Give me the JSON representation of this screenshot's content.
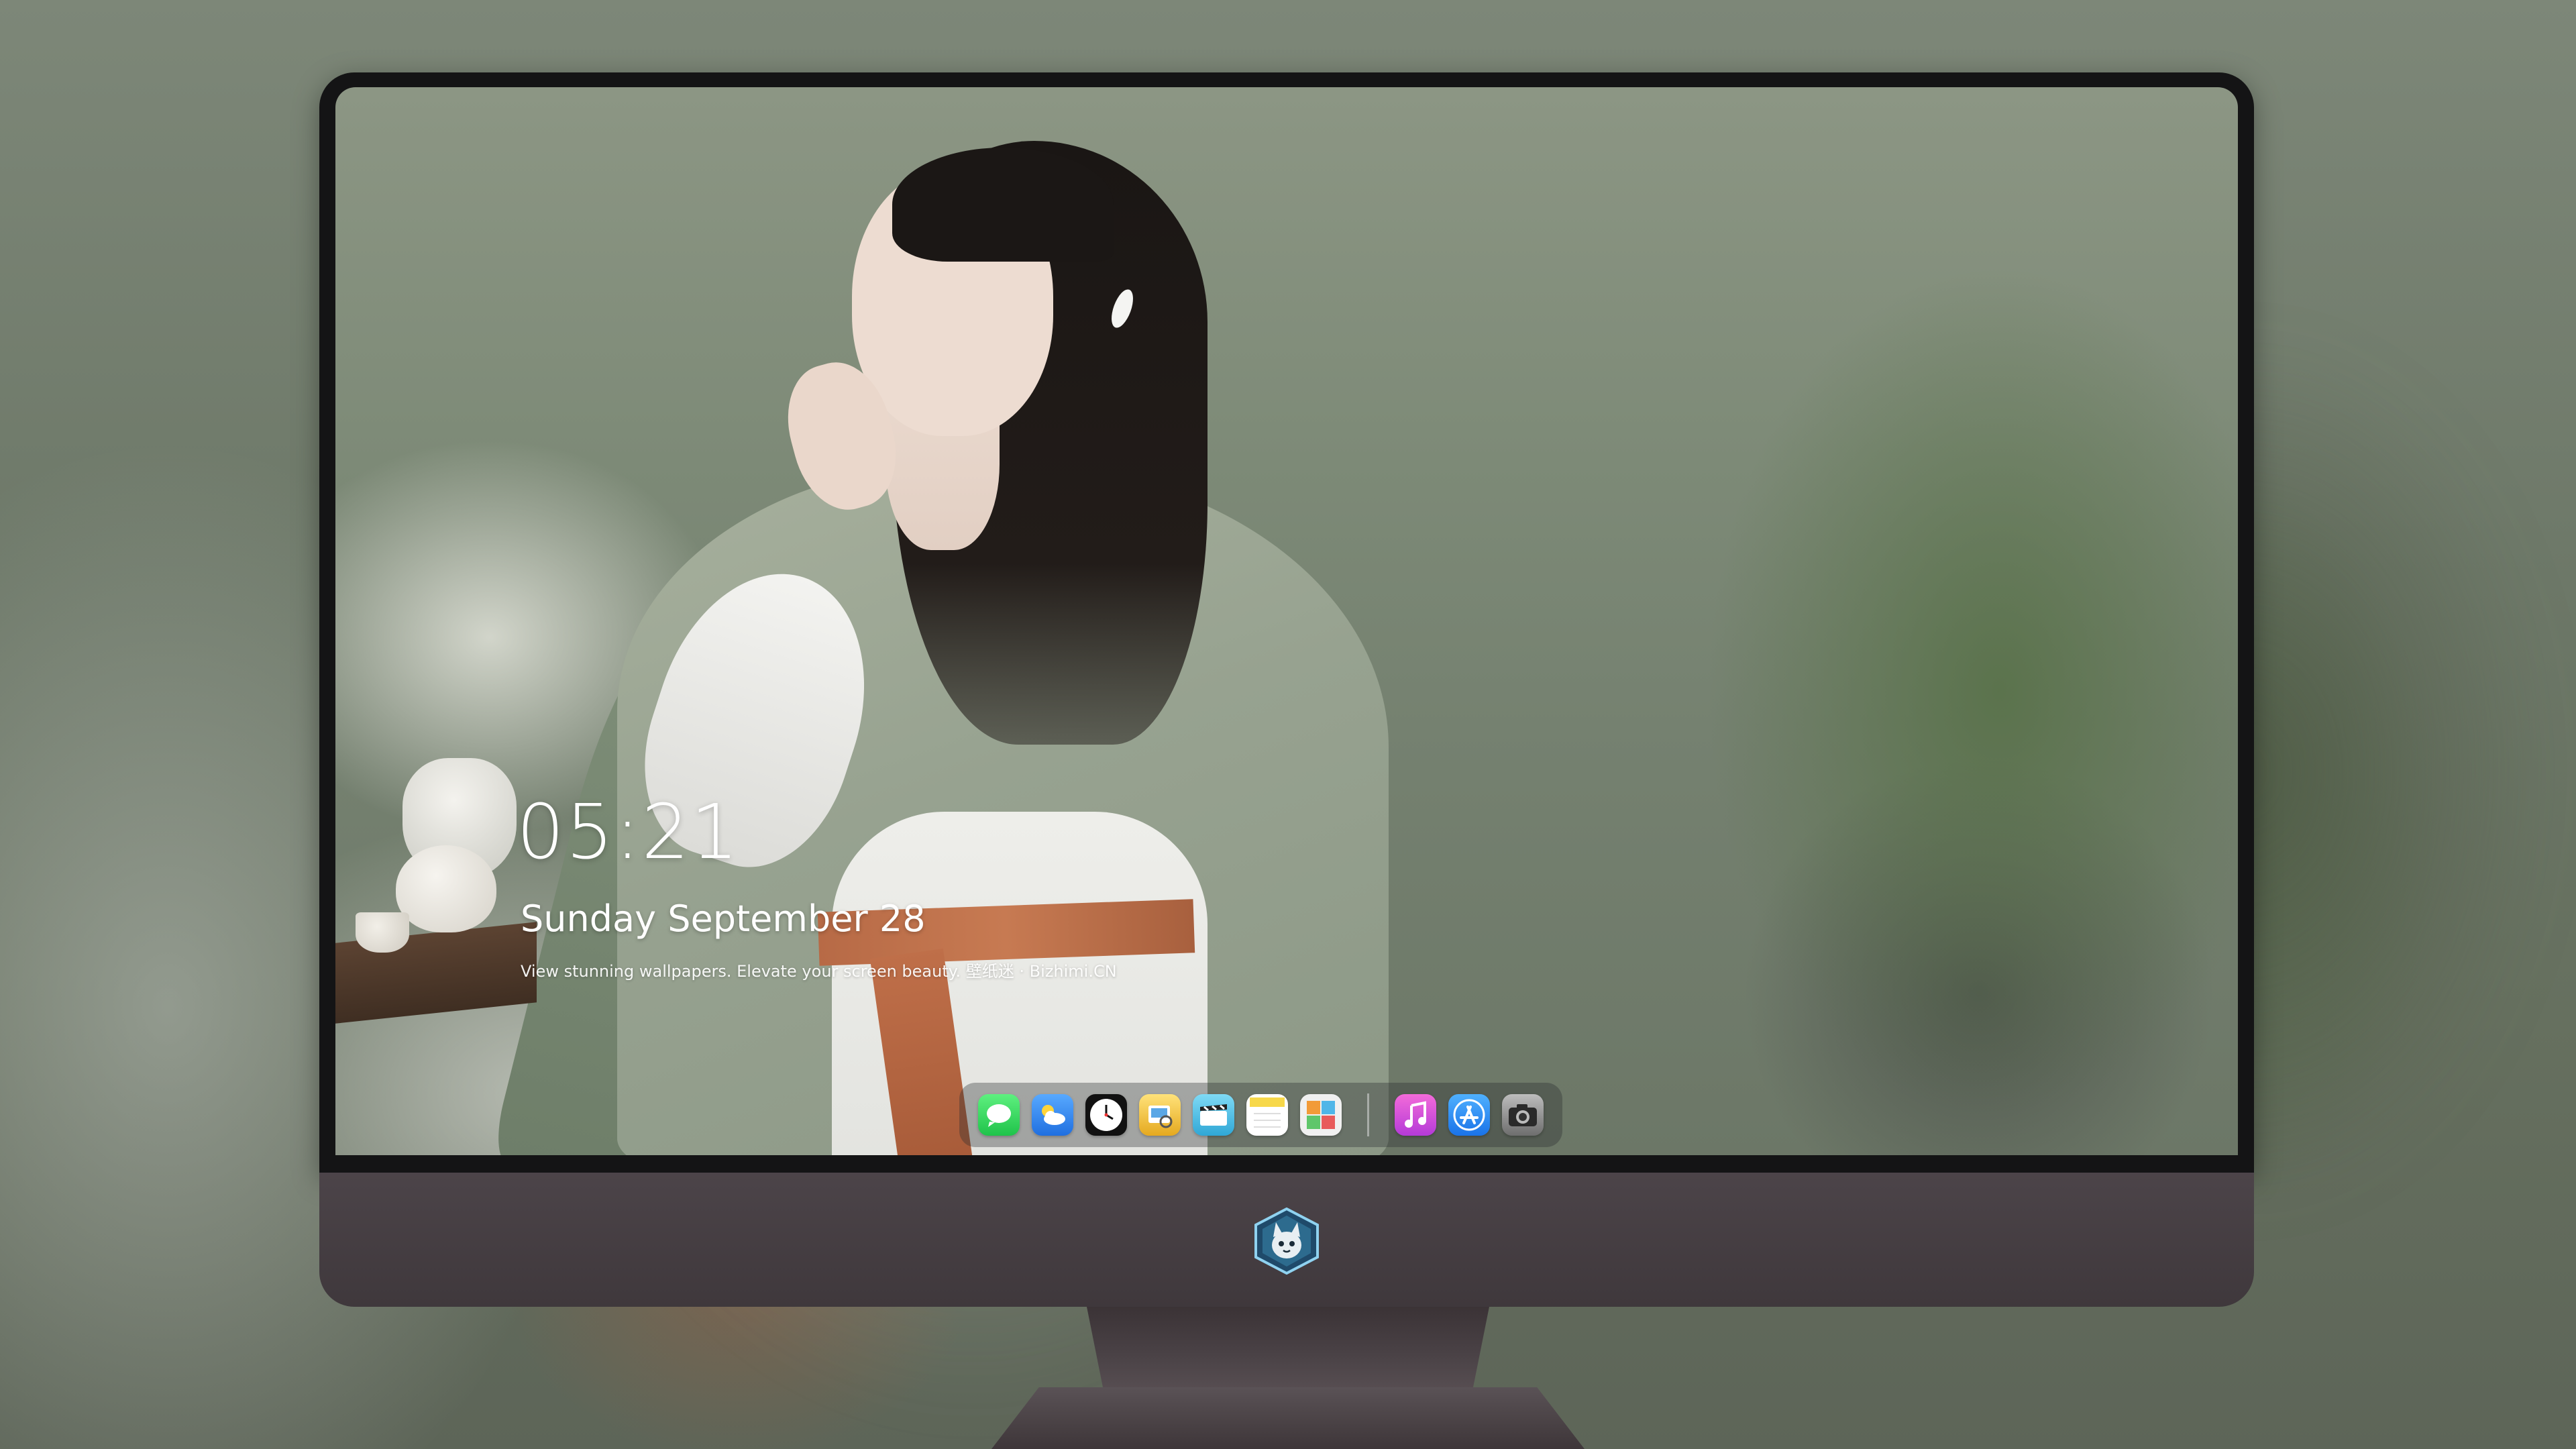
{
  "lock_screen": {
    "time": "05:21",
    "date": "Sunday September  28",
    "tagline": "View stunning wallpapers. Elevate your screen beauty. 壁纸迷 · Bizhimi.CN"
  },
  "dock": {
    "apps": [
      {
        "name": "messages",
        "color": "#2fd158"
      },
      {
        "name": "weather",
        "color": "#3b8ff0"
      },
      {
        "name": "clock",
        "color": "#1a1a1a"
      },
      {
        "name": "preview",
        "color": "#f3c53a"
      },
      {
        "name": "video-clips",
        "color": "#5bc2e7"
      },
      {
        "name": "notes",
        "color": "#f7d84a"
      },
      {
        "name": "photo-gallery",
        "color": "#e9e9e9"
      },
      {
        "name": "music",
        "color": "#e449c7"
      },
      {
        "name": "app-store",
        "color": "#2a8df4"
      },
      {
        "name": "camera",
        "color": "#8a8a8a"
      }
    ]
  },
  "monitor": {
    "logo": "cat-logo-icon"
  }
}
